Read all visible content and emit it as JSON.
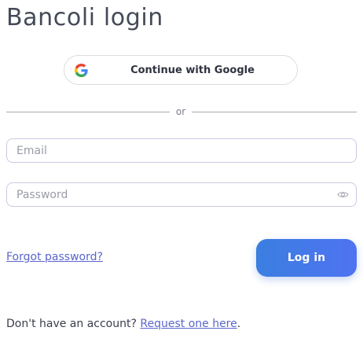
{
  "page": {
    "title": "Bancoli login"
  },
  "google": {
    "label": "Continue with Google",
    "icon": "google-g-icon"
  },
  "divider": {
    "text": "or"
  },
  "form": {
    "email_placeholder": "Email",
    "password_placeholder": "Password",
    "password_toggle_icon": "eye-icon",
    "forgot_label": "Forgot password?",
    "login_label": "Log in"
  },
  "signup": {
    "prompt": "Don't have an account?",
    "link_label": "Request one here",
    "suffix": "."
  },
  "colors": {
    "accent_start": "#3b7ee0",
    "accent_end": "#4f73f2",
    "link": "#5a66cc",
    "title": "#444a58"
  }
}
